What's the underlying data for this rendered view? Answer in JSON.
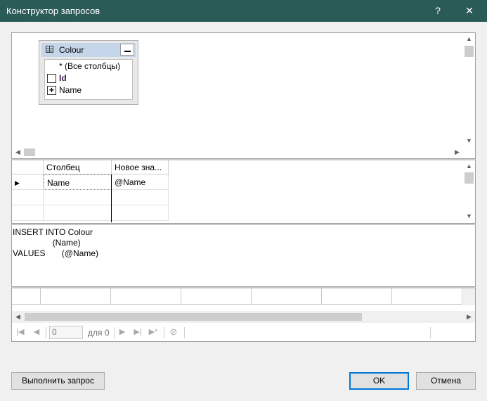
{
  "window": {
    "title": "Конструктор запросов",
    "help_label": "?",
    "close_label": "✕"
  },
  "diagram": {
    "table": {
      "name": "Colour",
      "columns": [
        {
          "label": "* (Все столбцы)",
          "checked": false,
          "mark": "",
          "bold": false
        },
        {
          "label": "Id",
          "checked": false,
          "mark": "",
          "bold": true
        },
        {
          "label": "Name",
          "checked": true,
          "mark": "+",
          "bold": false
        }
      ]
    }
  },
  "grid": {
    "headers": [
      "Столбец",
      "Новое зна..."
    ],
    "rows": [
      {
        "column": "Name",
        "new_value": "@Name"
      }
    ]
  },
  "sql": {
    "text": "INSERT INTO Colour\n                 (Name)\nVALUES       (@Name)"
  },
  "navigator": {
    "page_value": "0",
    "page_of": "для 0"
  },
  "buttons": {
    "execute": "Выполнить запрос",
    "ok": "OK",
    "cancel": "Отмена"
  },
  "colors": {
    "titlebar": "#2b5b57",
    "ok_border": "#0078d7"
  }
}
